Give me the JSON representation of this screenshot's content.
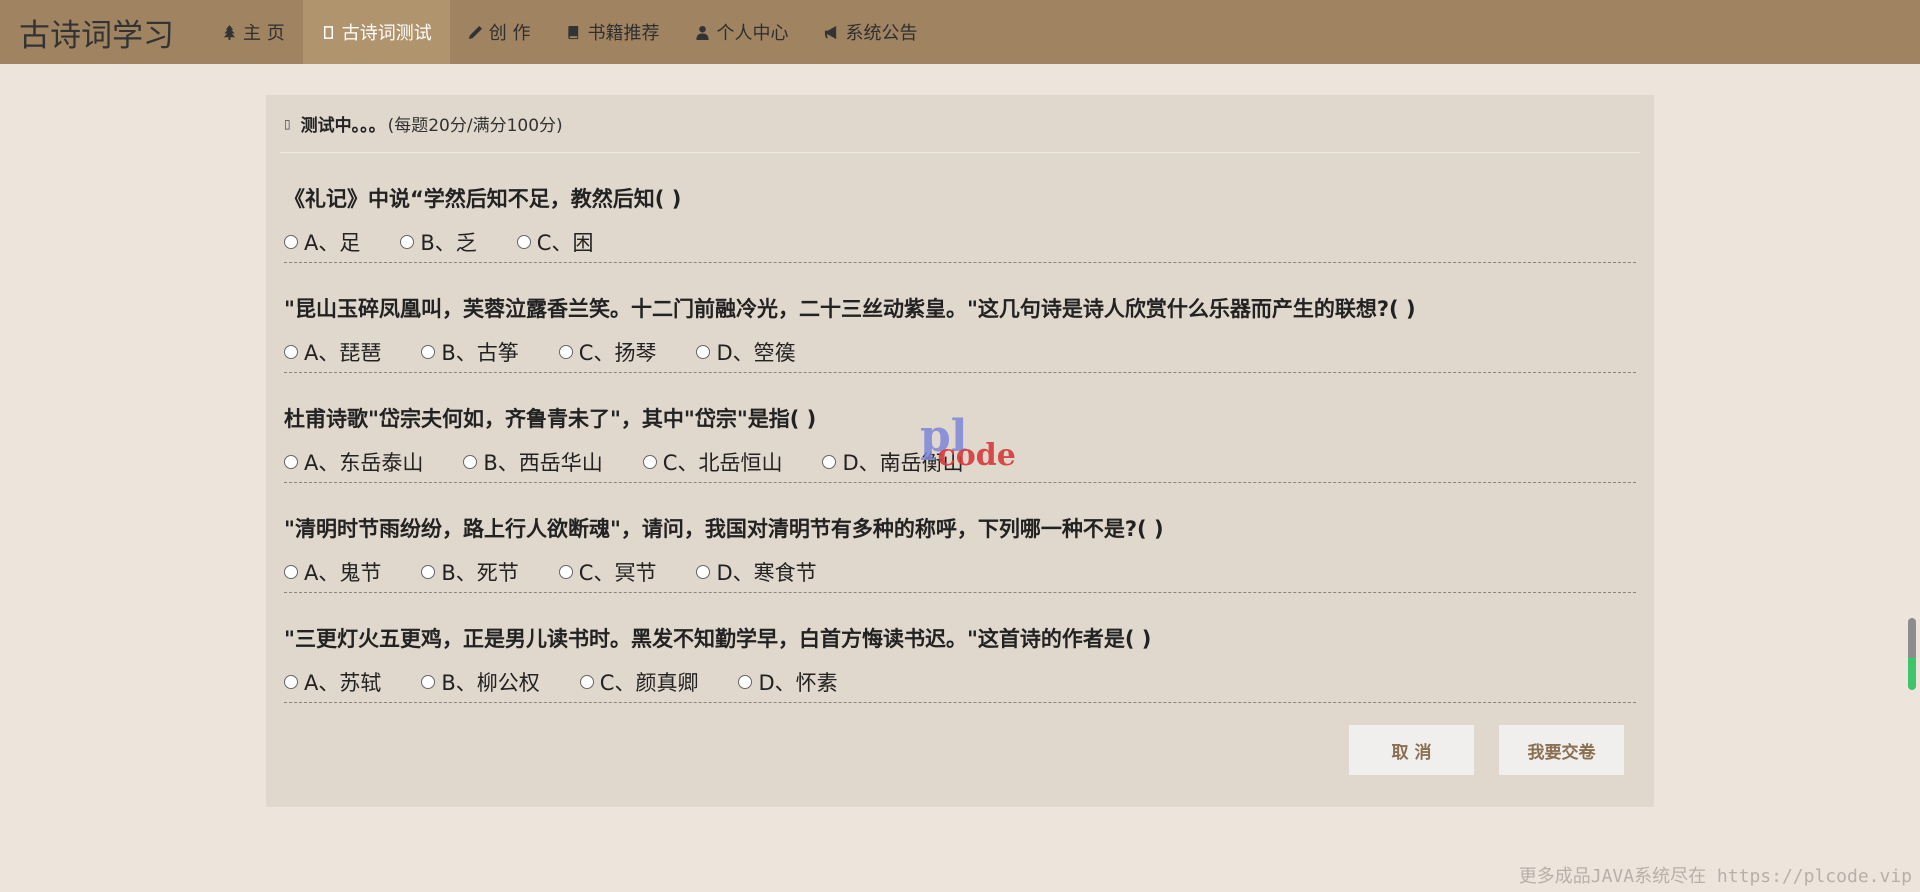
{
  "nav": {
    "brand": "古诗词学习",
    "items": [
      {
        "label": "主 页",
        "icon": "tree-icon"
      },
      {
        "label": "古诗词测试",
        "icon": "test-icon",
        "active": true
      },
      {
        "label": "创 作",
        "icon": "pencil-icon"
      },
      {
        "label": "书籍推荐",
        "icon": "book-icon"
      },
      {
        "label": "个人中心",
        "icon": "user-icon"
      },
      {
        "label": "系统公告",
        "icon": "bullhorn-icon"
      }
    ]
  },
  "panel": {
    "status": "测试中。。。",
    "note": "(每题20分/满分100分)"
  },
  "questions": [
    {
      "text": "《礼记》中说“学然后知不足，教然后知( )",
      "options": [
        "A、足",
        "B、乏",
        "C、困"
      ]
    },
    {
      "text": "\"昆山玉碎凤凰叫，芙蓉泣露香兰笑。十二门前融冷光，二十三丝动紫皇。\"这几句诗是诗人欣赏什么乐器而产生的联想?( )",
      "options": [
        "A、琵琶",
        "B、古筝",
        "C、扬琴",
        "D、箜篌"
      ]
    },
    {
      "text": "杜甫诗歌\"岱宗夫何如，齐鲁青未了\"，其中\"岱宗\"是指( )",
      "options": [
        "A、东岳泰山",
        "B、西岳华山",
        "C、北岳恒山",
        "D、南岳衡山"
      ]
    },
    {
      "text": "\"清明时节雨纷纷，路上行人欲断魂\"，请问，我国对清明节有多种的称呼，下列哪一种不是?( )",
      "options": [
        "A、鬼节",
        "B、死节",
        "C、冥节",
        "D、寒食节"
      ]
    },
    {
      "text": "\"三更灯火五更鸡，正是男儿读书时。黑发不知勤学早，白首方悔读书迟。\"这首诗的作者是( )",
      "options": [
        "A、苏轼",
        "B、柳公权",
        "C、颜真卿",
        "D、怀素"
      ]
    }
  ],
  "buttons": {
    "cancel": "取 消",
    "submit": "我要交卷"
  },
  "watermark": {
    "a": "pl",
    "b": "code"
  },
  "footer": "更多成品JAVA系统尽在 https://plcode.vip",
  "colors": {
    "navbar": "#a08462",
    "nav_active": "#b0946d",
    "page_bg": "#ede4dc",
    "panel_bg": "#e0d7cd",
    "button_text": "#8a6f52"
  }
}
